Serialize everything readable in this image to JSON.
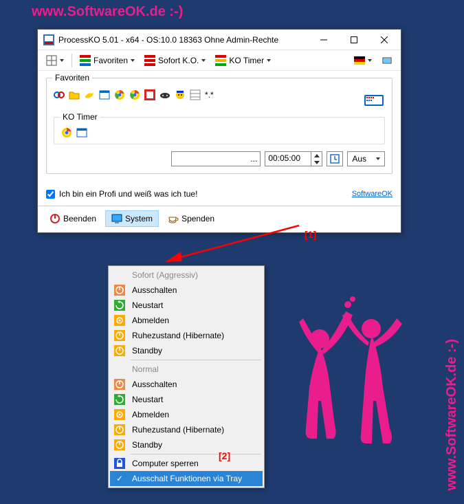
{
  "watermark": "www.SoftwareOK.de :-)",
  "window": {
    "title": "ProcessKO 5.01 - x64  - OS:10.0 18363 Ohne Admin-Rechte"
  },
  "toolbar": {
    "favoriten": "Favoriten",
    "sofort": "Sofort K.O.",
    "timer": "KO Timer"
  },
  "favGroup": {
    "legend": "Favoriten",
    "wildcard": "*.*"
  },
  "koGroup": {
    "legend": "KO Timer",
    "dots": "...",
    "time": "00:05:00",
    "aus": "Aus"
  },
  "footer": {
    "checkbox_label": "Ich bin ein Profi und weiß was ich tue!",
    "link": "SoftwareOK"
  },
  "annot": {
    "one": "[1]",
    "two": "[2]"
  },
  "bottomBar": {
    "beenden": "Beenden",
    "system": "System",
    "spenden": "Spenden"
  },
  "menu": {
    "head1": "Sofort (Aggressiv)",
    "head2": "Normal",
    "ausschalten": "Ausschalten",
    "neustart": "Neustart",
    "abmelden": "Abmelden",
    "hibernate": "Ruhezustand (Hibernate)",
    "standby": "Standby",
    "lock": "Computer sperren",
    "tray": "Ausschalt Funktionen via Tray"
  }
}
